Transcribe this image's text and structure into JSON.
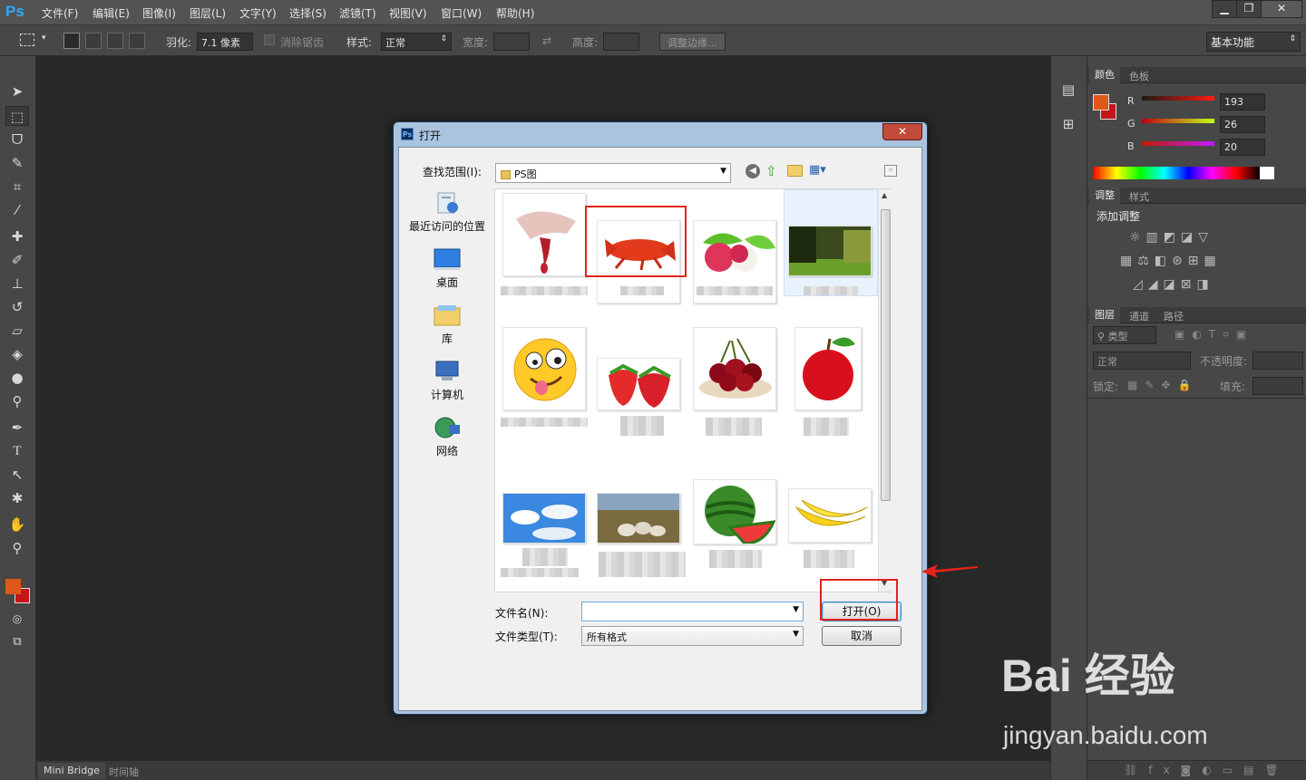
{
  "app": {
    "logo": "Ps"
  },
  "menu": [
    "文件(F)",
    "编辑(E)",
    "图像(I)",
    "图层(L)",
    "文字(Y)",
    "选择(S)",
    "滤镜(T)",
    "视图(V)",
    "窗口(W)",
    "帮助(H)"
  ],
  "window_controls": {
    "minimize": "▁",
    "restore": "❐",
    "close": "✕"
  },
  "options": {
    "feather_label": "羽化:",
    "feather_value": "7.1 像素",
    "antialias_label": "消除锯齿",
    "style_label": "样式:",
    "style_value": "正常",
    "width_label": "宽度:",
    "height_label": "高度:",
    "refine_edge": "调整边缘...",
    "workspace": "基本功能"
  },
  "color_panel": {
    "tabs": [
      "颜色",
      "色板"
    ],
    "r_label": "R",
    "r_value": "193",
    "g_label": "G",
    "g_value": "26",
    "b_label": "B",
    "b_value": "20",
    "foreground": "#e0571a",
    "background": "#c1161a"
  },
  "adjust_panel": {
    "tabs": [
      "调整",
      "样式"
    ],
    "title": "添加调整"
  },
  "layers_panel": {
    "tabs": [
      "图层",
      "通道",
      "路径"
    ],
    "kind": "类型",
    "blend_mode": "正常",
    "opacity_label": "不透明度:",
    "lock_label": "锁定:",
    "fill_label": "填充:"
  },
  "bottom_tabs": [
    "Mini Bridge",
    "时间轴"
  ],
  "dialog": {
    "title": "打开",
    "ps_badge": "Ps",
    "close": "✕",
    "lookin_label": "查找范围(I):",
    "lookin_value": "PS图",
    "places": [
      "最近访问的位置",
      "桌面",
      "库",
      "计算机",
      "网络"
    ],
    "thumbnails": [
      {
        "name": "hands-heart"
      },
      {
        "name": "crayfish"
      },
      {
        "name": "lychee"
      },
      {
        "name": "forest"
      },
      {
        "name": "emoji"
      },
      {
        "name": "strawberry"
      },
      {
        "name": "cherries"
      },
      {
        "name": "apple"
      },
      {
        "name": "sky"
      },
      {
        "name": "sheep"
      },
      {
        "name": "watermelon"
      },
      {
        "name": "banana"
      }
    ],
    "filename_label": "文件名(N):",
    "filename_value": "",
    "filetype_label": "文件类型(T):",
    "filetype_value": "所有格式",
    "open_button": "打开(O)",
    "cancel_button": "取消"
  },
  "watermark": {
    "brand": "Bai 经验",
    "url": "jingyan.baidu.com"
  }
}
